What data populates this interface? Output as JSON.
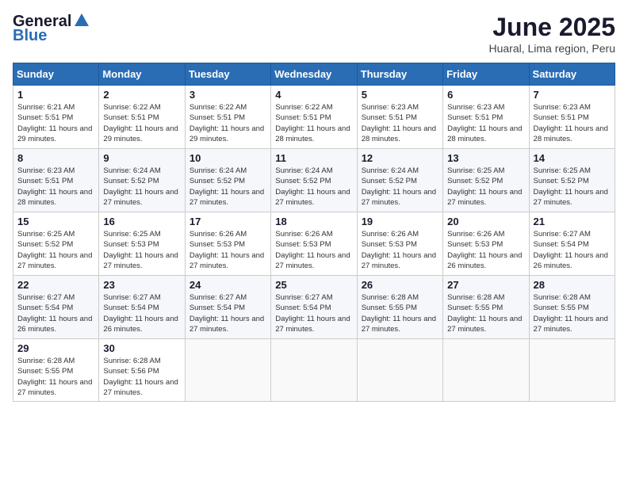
{
  "logo": {
    "general": "General",
    "blue": "Blue"
  },
  "title": "June 2025",
  "subtitle": "Huaral, Lima region, Peru",
  "days_of_week": [
    "Sunday",
    "Monday",
    "Tuesday",
    "Wednesday",
    "Thursday",
    "Friday",
    "Saturday"
  ],
  "weeks": [
    [
      {
        "day": "1",
        "sunrise": "6:21 AM",
        "sunset": "5:51 PM",
        "daylight": "11 hours and 29 minutes."
      },
      {
        "day": "2",
        "sunrise": "6:22 AM",
        "sunset": "5:51 PM",
        "daylight": "11 hours and 29 minutes."
      },
      {
        "day": "3",
        "sunrise": "6:22 AM",
        "sunset": "5:51 PM",
        "daylight": "11 hours and 29 minutes."
      },
      {
        "day": "4",
        "sunrise": "6:22 AM",
        "sunset": "5:51 PM",
        "daylight": "11 hours and 28 minutes."
      },
      {
        "day": "5",
        "sunrise": "6:23 AM",
        "sunset": "5:51 PM",
        "daylight": "11 hours and 28 minutes."
      },
      {
        "day": "6",
        "sunrise": "6:23 AM",
        "sunset": "5:51 PM",
        "daylight": "11 hours and 28 minutes."
      },
      {
        "day": "7",
        "sunrise": "6:23 AM",
        "sunset": "5:51 PM",
        "daylight": "11 hours and 28 minutes."
      }
    ],
    [
      {
        "day": "8",
        "sunrise": "6:23 AM",
        "sunset": "5:51 PM",
        "daylight": "11 hours and 28 minutes."
      },
      {
        "day": "9",
        "sunrise": "6:24 AM",
        "sunset": "5:52 PM",
        "daylight": "11 hours and 27 minutes."
      },
      {
        "day": "10",
        "sunrise": "6:24 AM",
        "sunset": "5:52 PM",
        "daylight": "11 hours and 27 minutes."
      },
      {
        "day": "11",
        "sunrise": "6:24 AM",
        "sunset": "5:52 PM",
        "daylight": "11 hours and 27 minutes."
      },
      {
        "day": "12",
        "sunrise": "6:24 AM",
        "sunset": "5:52 PM",
        "daylight": "11 hours and 27 minutes."
      },
      {
        "day": "13",
        "sunrise": "6:25 AM",
        "sunset": "5:52 PM",
        "daylight": "11 hours and 27 minutes."
      },
      {
        "day": "14",
        "sunrise": "6:25 AM",
        "sunset": "5:52 PM",
        "daylight": "11 hours and 27 minutes."
      }
    ],
    [
      {
        "day": "15",
        "sunrise": "6:25 AM",
        "sunset": "5:52 PM",
        "daylight": "11 hours and 27 minutes."
      },
      {
        "day": "16",
        "sunrise": "6:25 AM",
        "sunset": "5:53 PM",
        "daylight": "11 hours and 27 minutes."
      },
      {
        "day": "17",
        "sunrise": "6:26 AM",
        "sunset": "5:53 PM",
        "daylight": "11 hours and 27 minutes."
      },
      {
        "day": "18",
        "sunrise": "6:26 AM",
        "sunset": "5:53 PM",
        "daylight": "11 hours and 27 minutes."
      },
      {
        "day": "19",
        "sunrise": "6:26 AM",
        "sunset": "5:53 PM",
        "daylight": "11 hours and 27 minutes."
      },
      {
        "day": "20",
        "sunrise": "6:26 AM",
        "sunset": "5:53 PM",
        "daylight": "11 hours and 26 minutes."
      },
      {
        "day": "21",
        "sunrise": "6:27 AM",
        "sunset": "5:54 PM",
        "daylight": "11 hours and 26 minutes."
      }
    ],
    [
      {
        "day": "22",
        "sunrise": "6:27 AM",
        "sunset": "5:54 PM",
        "daylight": "11 hours and 26 minutes."
      },
      {
        "day": "23",
        "sunrise": "6:27 AM",
        "sunset": "5:54 PM",
        "daylight": "11 hours and 26 minutes."
      },
      {
        "day": "24",
        "sunrise": "6:27 AM",
        "sunset": "5:54 PM",
        "daylight": "11 hours and 27 minutes."
      },
      {
        "day": "25",
        "sunrise": "6:27 AM",
        "sunset": "5:54 PM",
        "daylight": "11 hours and 27 minutes."
      },
      {
        "day": "26",
        "sunrise": "6:28 AM",
        "sunset": "5:55 PM",
        "daylight": "11 hours and 27 minutes."
      },
      {
        "day": "27",
        "sunrise": "6:28 AM",
        "sunset": "5:55 PM",
        "daylight": "11 hours and 27 minutes."
      },
      {
        "day": "28",
        "sunrise": "6:28 AM",
        "sunset": "5:55 PM",
        "daylight": "11 hours and 27 minutes."
      }
    ],
    [
      {
        "day": "29",
        "sunrise": "6:28 AM",
        "sunset": "5:55 PM",
        "daylight": "11 hours and 27 minutes."
      },
      {
        "day": "30",
        "sunrise": "6:28 AM",
        "sunset": "5:56 PM",
        "daylight": "11 hours and 27 minutes."
      },
      null,
      null,
      null,
      null,
      null
    ]
  ]
}
